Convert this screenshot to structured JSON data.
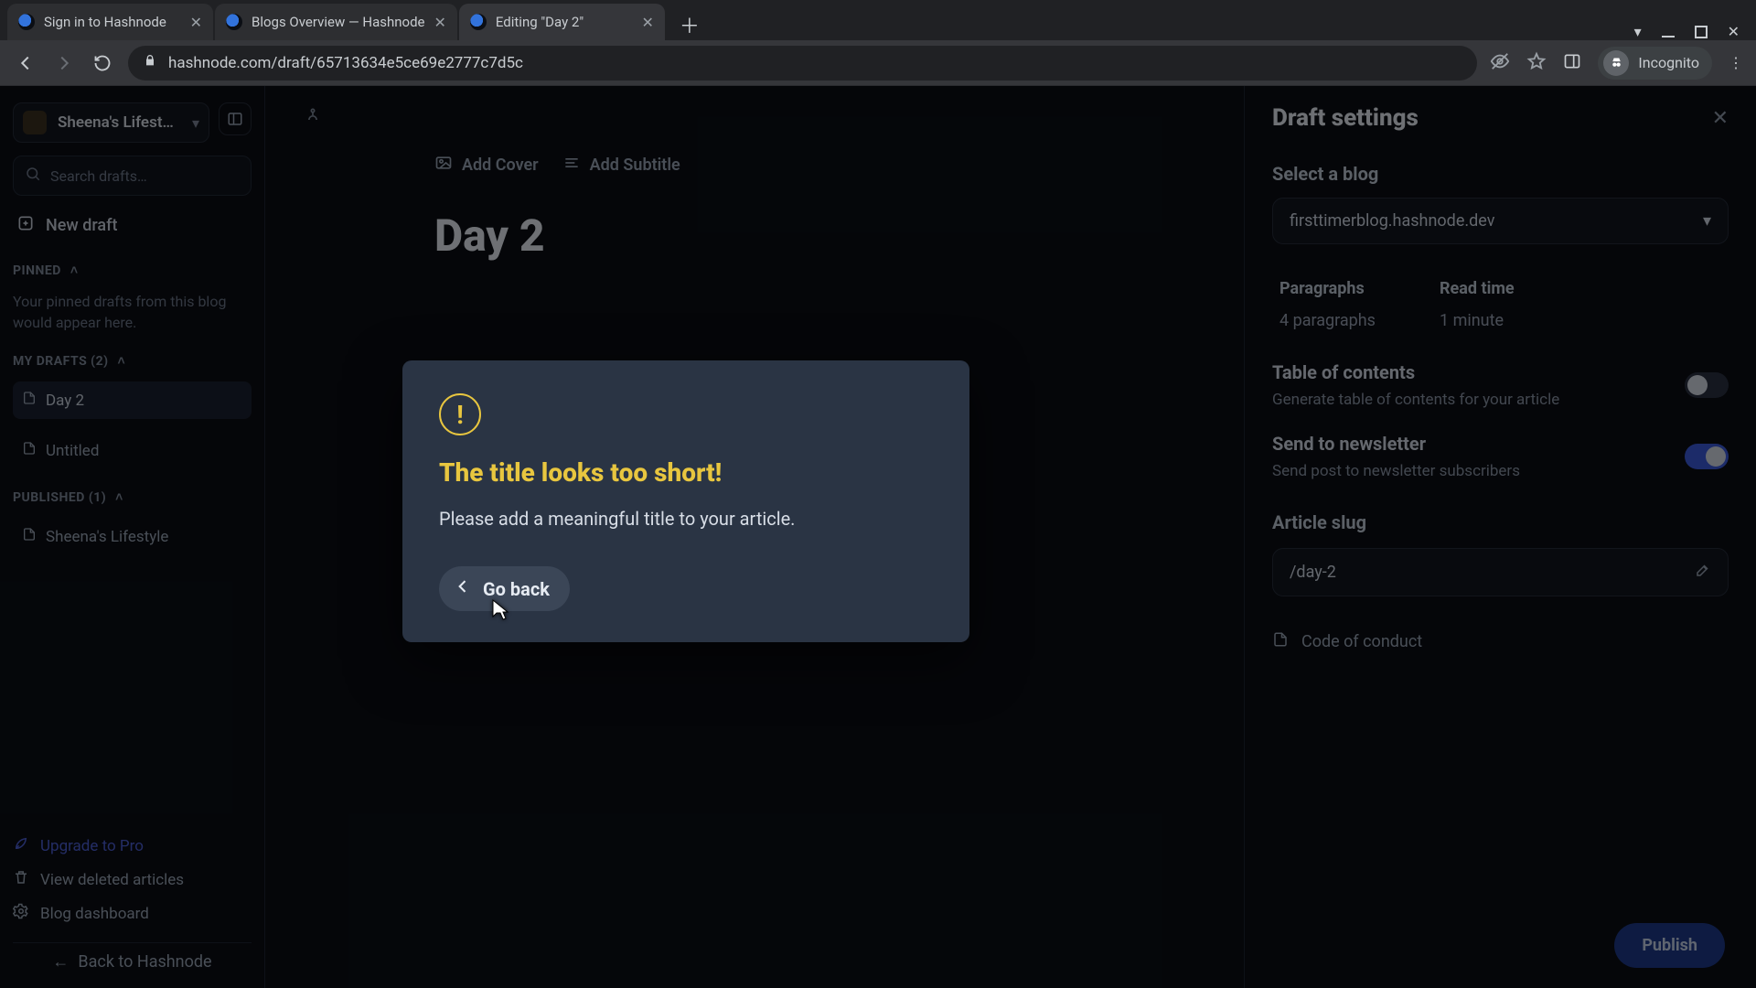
{
  "browser": {
    "tabs": [
      {
        "title": "Sign in to Hashnode",
        "active": false
      },
      {
        "title": "Blogs Overview — Hashnode",
        "active": false
      },
      {
        "title": "Editing \"Day 2\"",
        "active": true
      }
    ],
    "url": "hashnode.com/draft/65713634e5ce69e2777c7d5c",
    "incognito_label": "Incognito"
  },
  "sidebar": {
    "blog_name": "Sheena's Lifest…",
    "search_placeholder": "Search drafts…",
    "new_draft": "New draft",
    "pinned_label": "Pinned",
    "pinned_empty": "Your pinned drafts from this blog would appear here.",
    "my_drafts_label": "My Drafts (2)",
    "drafts": [
      {
        "title": "Day 2",
        "active": true
      },
      {
        "title": "Untitled",
        "active": false
      }
    ],
    "published_label": "Published (1)",
    "published": [
      {
        "title": "Sheena's Lifestyle"
      }
    ],
    "upgrade": "Upgrade to Pro",
    "deleted": "View deleted articles",
    "dashboard": "Blog dashboard",
    "back": "Back to Hashnode"
  },
  "editor": {
    "add_cover": "Add Cover",
    "add_subtitle": "Add Subtitle",
    "title": "Day 2"
  },
  "settings": {
    "heading": "Draft settings",
    "select_blog_label": "Select a blog",
    "blog_value": "firsttimerblog.hashnode.dev",
    "stats": {
      "paragraphs_label": "Paragraphs",
      "paragraphs_value": "4 paragraphs",
      "readtime_label": "Read time",
      "readtime_value": "1 minute"
    },
    "toc": {
      "title": "Table of contents",
      "sub": "Generate table of contents for your article",
      "on": false
    },
    "newsletter": {
      "title": "Send to newsletter",
      "sub": "Send post to newsletter subscribers",
      "on": true
    },
    "slug_label": "Article slug",
    "slug_value": "/day-2",
    "coc": "Code of conduct",
    "publish": "Publish"
  },
  "modal": {
    "title": "The title looks too short!",
    "body": "Please add a meaningful title to your article.",
    "go_back": "Go back"
  }
}
